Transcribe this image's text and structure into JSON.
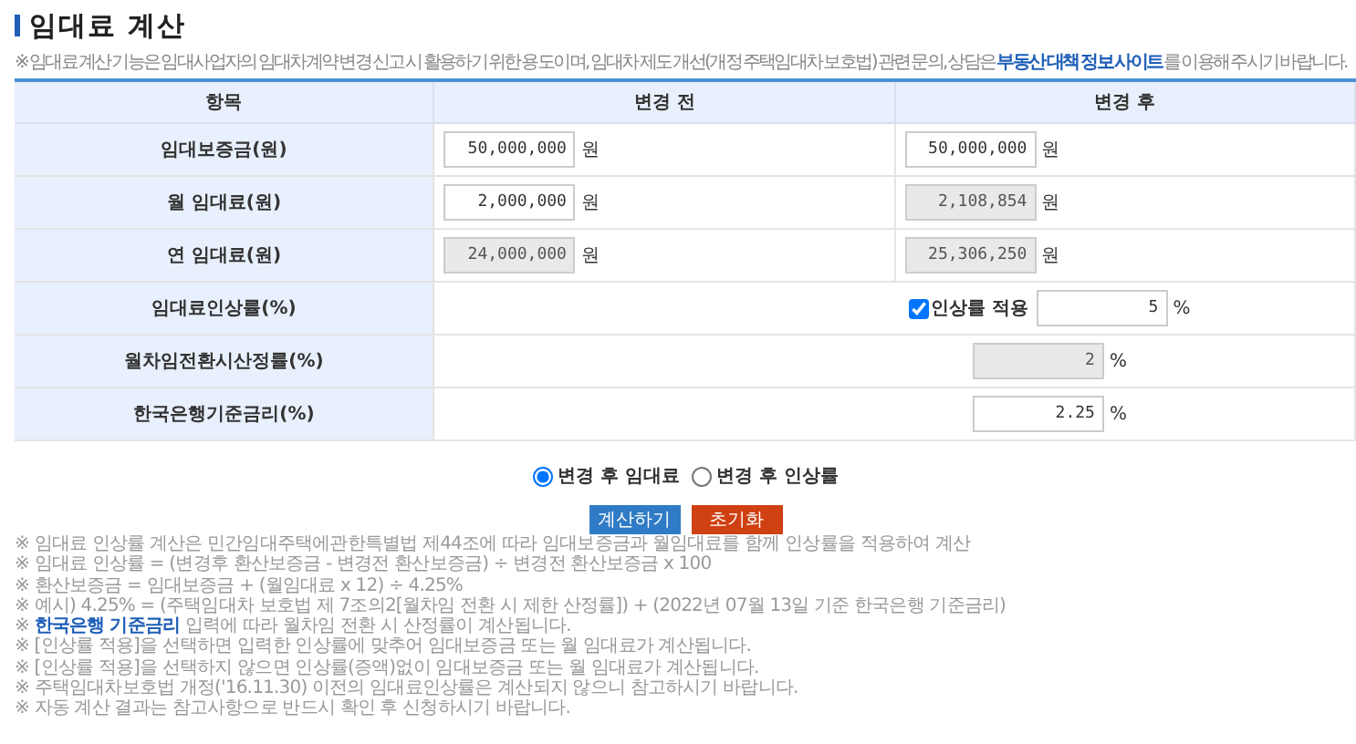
{
  "title": "임대료 계산",
  "intro": {
    "before": "※ 임대료 계산 기능은 임대사업자의 임대차계약 변경 신고 시 활용하기 위한 용도이며, 임대차 제도 개선(개정 주택임대차 보호법) 관련 문의, 상담은 ",
    "link": "부동산 대책 정보 사이트",
    "after": " 를 이용해 주시기 바랍니다."
  },
  "table": {
    "columns": [
      "항목",
      "변경 전",
      "변경 후"
    ],
    "rows": [
      {
        "kind": "pair",
        "label": "임대보증금(원)",
        "before": {
          "value": "50,000,000",
          "unit": "원",
          "readonly": false
        },
        "after": {
          "value": "50,000,000",
          "unit": "원",
          "readonly": false
        }
      },
      {
        "kind": "pair",
        "label": "월 임대료(원)",
        "before": {
          "value": "2,000,000",
          "unit": "원",
          "readonly": false
        },
        "after": {
          "value": "2,108,854",
          "unit": "원",
          "readonly": true
        }
      },
      {
        "kind": "pair",
        "label": "연 임대료(원)",
        "before": {
          "value": "24,000,000",
          "unit": "원",
          "readonly": true
        },
        "after": {
          "value": "25,306,250",
          "unit": "원",
          "readonly": true
        }
      },
      {
        "kind": "checkbox",
        "label": "임대료인상률(%)",
        "check_label": "인상률 적용",
        "checked": true,
        "value": "5",
        "unit": "%",
        "readonly": false
      },
      {
        "kind": "single",
        "label": "월차임전환시산정률(%)",
        "value": "2",
        "unit": "%",
        "readonly": true
      },
      {
        "kind": "single",
        "label": "한국은행기준금리(%)",
        "value": "2.25",
        "unit": "%",
        "readonly": false
      }
    ]
  },
  "radios": [
    {
      "label": "변경 후 임대료",
      "selected": true
    },
    {
      "label": "변경 후 인상률",
      "selected": false
    }
  ],
  "buttons": [
    {
      "label": "계산하기",
      "kind": "primary"
    },
    {
      "label": "초기화",
      "kind": "reset"
    }
  ],
  "notes": [
    {
      "text": "※ 임대료 인상률 계산은 민간임대주택에관한특별법 제44조에 따라 임대보증금과 월임대료를 함께 인상률을 적용하여 계산"
    },
    {
      "text": "※ 임대료 인상률 = (변경후 환산보증금 - 변경전 환산보증금) ÷ 변경전 환산보증금 x 100"
    },
    {
      "text": "※ 환산보증금 = 임대보증금 + (월임대료 x 12) ÷ 4.25%"
    },
    {
      "text": "※ 예시) 4.25% = (주택임대차 보호법 제 7조의2[월차임 전환 시 제한 산정률]) + (2022년 07월 13일 기준 한국은행 기준금리)"
    },
    {
      "prefix": "※ ",
      "link": "한국은행 기준금리",
      "text": " 입력에 따라 월차임 전환 시 산정률이 계산됩니다."
    },
    {
      "text": "※ [인상률 적용]을 선택하면 입력한 인상률에 맞추어 임대보증금 또는 월 임대료가 계산됩니다."
    },
    {
      "text": "※ [인상률 적용]을 선택하지 않으면 인상률(증액)없이 임대보증금 또는 월 임대료가 계산됩니다."
    },
    {
      "text": "※ 주택임대차보호법 개정('16.11.30) 이전의 임대료인상률은 계산되지 않으니 참고하시기 바랍니다."
    },
    {
      "text": "※ 자동 계산 결과는 참고사항으로 반드시 확인 후 신청하시기 바랍니다."
    }
  ]
}
